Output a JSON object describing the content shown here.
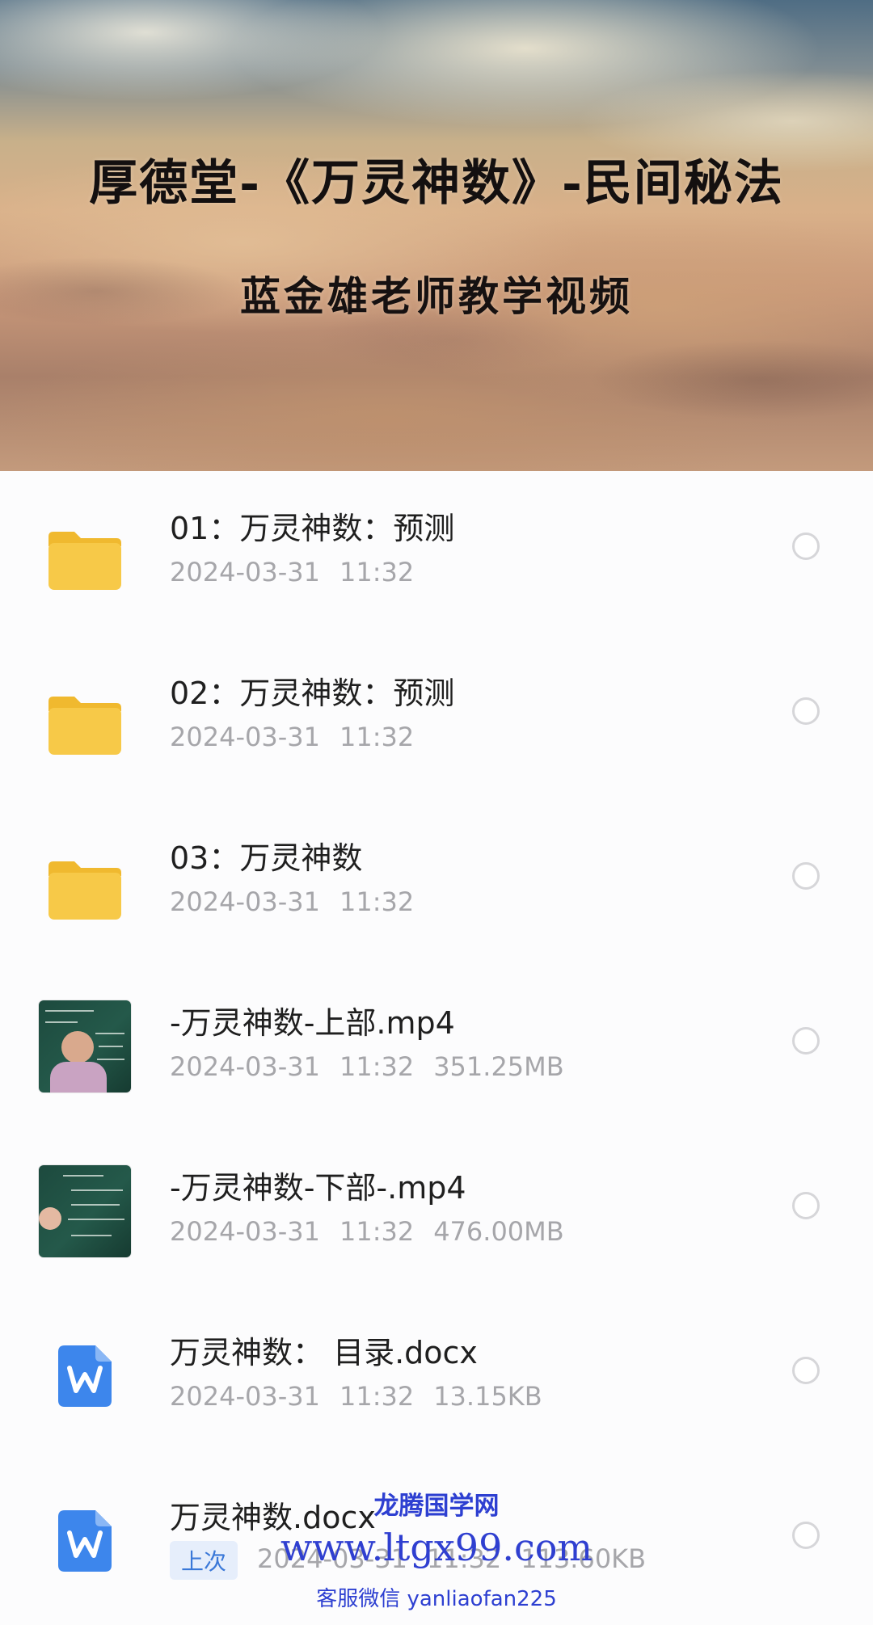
{
  "banner": {
    "title": "厚德堂-《万灵神数》-民间秘法",
    "subtitle": "蓝金雄老师教学视频"
  },
  "files": [
    {
      "name": "01：万灵神数：预测",
      "date": "2024-03-31",
      "time": "11:32",
      "size": "",
      "type": "folder",
      "icon": "folder-icon"
    },
    {
      "name": "02：万灵神数：预测",
      "date": "2024-03-31",
      "time": "11:32",
      "size": "",
      "type": "folder",
      "icon": "folder-icon"
    },
    {
      "name": "03：万灵神数",
      "date": "2024-03-31",
      "time": "11:32",
      "size": "",
      "type": "folder",
      "icon": "folder-icon"
    },
    {
      "name": "-万灵神数-上部.mp4",
      "date": "2024-03-31",
      "time": "11:32",
      "size": "351.25MB",
      "type": "video",
      "icon": "video-thumbnail"
    },
    {
      "name": "-万灵神数-下部-.mp4",
      "date": "2024-03-31",
      "time": "11:32",
      "size": "476.00MB",
      "type": "video",
      "icon": "video-thumbnail"
    },
    {
      "name": "万灵神数： 目录.docx",
      "date": "2024-03-31",
      "time": "11:32",
      "size": "13.15KB",
      "type": "word",
      "icon": "word-doc-icon"
    },
    {
      "name": "万灵神数.docx",
      "date": "2024-03-31",
      "time": "11:32",
      "size": "113.60KB",
      "type": "word",
      "icon": "word-doc-icon",
      "badge": "上次"
    }
  ],
  "watermark": {
    "line1": "龙腾国学网",
    "line2": "www.ltgx99.com",
    "line3": "客服微信 yanliaofan225"
  },
  "colors": {
    "folder": "#f7c948",
    "word": "#3d86ec",
    "badge_bg": "#e6eefb",
    "badge_text": "#3a78d8",
    "watermark": "#2d3fd1"
  }
}
